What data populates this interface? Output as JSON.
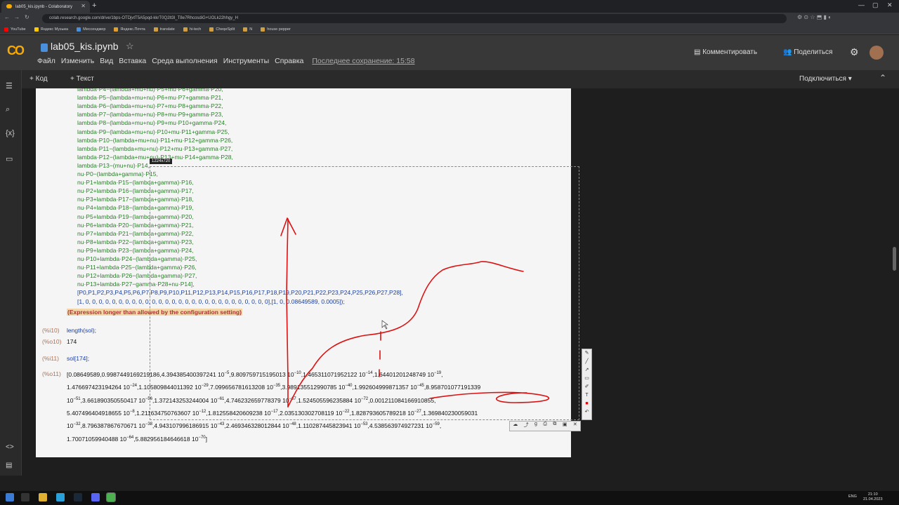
{
  "browser": {
    "tab_title": "lab05_kis.ipynb - Colaboratory",
    "url": "colab.research.google.com/drive/1bps-OTDjvtT5A5pqd-kkrT0Q2lt3I_T8e7RhcosdiG+UOLk22hhgy_H",
    "bookmarks": [
      "YouTube",
      "Яндекс Музыка",
      "Мессенджер",
      "Яндекс.Почта",
      "translate",
      "hi-tech",
      "CheqeSplit",
      "N",
      "house pepper"
    ],
    "bookmark_colors": [
      "#ff0000",
      "#ffcc00",
      "#4a8fdb",
      "#e0a030",
      "#d0a040",
      "#d0a040",
      "#d0a040",
      "#d0a040",
      "#d0a040"
    ]
  },
  "colab": {
    "notebook_title": "lab05_kis.ipynb",
    "menu": [
      "Файл",
      "Изменить",
      "Вид",
      "Вставка",
      "Среда выполнения",
      "Инструменты",
      "Справка"
    ],
    "last_saved": "Последнее сохранение: 15:58",
    "comment_label": "Комментировать",
    "share_label": "Поделиться",
    "add_code_label": "+ Код",
    "add_text_label": "+ Текст",
    "connect_label": "Подключиться"
  },
  "cell": {
    "code_lines": [
      "lambda·P4−(lambda+mu+nu)·P5+mu·P6+gamma·P20,",
      "lambda·P5−(lambda+mu+nu)·P6+mu·P7+gamma·P21,",
      "lambda·P6−(lambda+mu+nu)·P7+mu·P8+gamma·P22,",
      "lambda·P7−(lambda+mu+nu)·P8+mu·P9+gamma·P23,",
      "lambda·P8−(lambda+mu+nu)·P9+mu·P10+gamma·P24,",
      "lambda·P9−(lambda+mu+nu)·P10+mu·P11+gamma·P25,",
      "lambda·P10−(lambda+mu+nu)·P11+mu·P12+gamma·P26,",
      "lambda·P11−(lambda+mu+nu)·P12+mu·P13+gamma·P27,",
      "lambda·P12−(lambda+mu+nu)·P13+mu·P14+gamma·P28,",
      "lambda·P13−(mu+nu)·P14,",
      "nu·P0−(lambda+gamma)·P15,",
      "nu·P1+lambda·P15−(lambda+gamma)·P16,",
      "nu·P2+lambda·P16−(lambda+gamma)·P17,",
      "nu·P3+lambda·P17−(lambda+gamma)·P18,",
      "nu·P4+lambda·P18−(lambda+gamma)·P19,",
      "nu·P5+lambda·P19−(lambda+gamma)·P20,",
      "nu·P6+lambda·P20−(lambda+gamma)·P21,",
      "nu·P7+lambda·P21−(lambda+gamma)·P22,",
      "nu·P8+lambda·P22−(lambda+gamma)·P23,",
      "nu·P9+lambda·P23−(lambda+gamma)·P24,",
      "nu·P10+lambda·P24−(lambda+gamma)·P25,",
      "nu·P11+lambda·P25−(lambda+gamma)·P26,",
      "nu·P12+lambda·P26−(lambda+gamma)·P27,",
      "nu·P13+lambda·P27−gamma·P28+nu·P14],"
    ],
    "vars_line": "[P0,P1,P2,P3,P4,P5,P6,P7,P8,P9,P10,P11,P12,P13,P14,P15,P16,P17,P18,P19,P20,P21,P22,P23,P24,P25,P26,P27,P28],",
    "init_line": "[1, 0, 0, 0, 0, 0, 0, 0, 0, 0, 0, 0, 0, 0, 0, 0, 0, 0, 0, 0, 0, 0, 0, 0, 0, 0, 0, 0, 0],[1, 0, 0.08649589, 0.0005]);",
    "error": "(Expression longer than allowed by the configuration setting)",
    "i10_prompt": "(%i10)",
    "i10_input": "length(sol);",
    "o10_prompt": "(%o10)",
    "o10_output": "174",
    "i11_prompt": "(%i11)",
    "i11_input": "sol[174];",
    "o11_prompt": "(%o11)",
    "out_rows": [
      [
        [
          "[0.08649589,0.9987449169219186,4.394385400397241 10",
          "−5"
        ],
        [
          ",9.809759715195013 10",
          "−10"
        ],
        [
          ",1.465311071952122 10",
          "−14"
        ],
        [
          ",1.64401201248749 10",
          "−19"
        ],
        [
          ",",
          ""
        ]
      ],
      [
        [
          "1.476697423194264 10",
          "−24"
        ],
        [
          ",1.105809844011392 10",
          "−29"
        ],
        [
          ",7.099656781613208 10",
          "−35"
        ],
        [
          ",3.989135512990785 10",
          "−40"
        ],
        [
          ",1.992604999871357 10",
          "−45"
        ],
        [
          ",8.958701077191339",
          ""
        ]
      ],
      [
        [
          "10",
          "−51"
        ],
        [
          ",3.661890350550417 10",
          "−56"
        ],
        [
          ",1.372143253244004 10",
          "−61"
        ],
        [
          ",4.746232659778379 10",
          "−67"
        ],
        [
          ",1.524505596235884 10",
          "−72"
        ],
        [
          ",0.001211084166910855,",
          ""
        ]
      ],
      [
        [
          "5.407496404918655 10",
          "−8"
        ],
        [
          ",1.211634750763607 10",
          "−12"
        ],
        [
          ",1.812558420609238 10",
          "−17"
        ],
        [
          ",2.035130302708119 10",
          "−22"
        ],
        [
          ",1.828793605789218 10",
          "−27"
        ],
        [
          ",1.369840230059031",
          ""
        ]
      ],
      [
        [
          "10",
          "−32"
        ],
        [
          ",8.796387867670671 10",
          "−38"
        ],
        [
          ",4.943107996186915 10",
          "−43"
        ],
        [
          ",2.469346328012844 10",
          "−48"
        ],
        [
          ",1.110287445823941 10",
          "−53"
        ],
        [
          ",4.538563974927231 10",
          "−59"
        ],
        [
          ",",
          ""
        ]
      ],
      [
        [
          "1.70071059940488 10",
          "−64"
        ],
        [
          ",5.882956184646618 10",
          "−70"
        ],
        [
          "]",
          ""
        ]
      ]
    ]
  },
  "overlay": {
    "size_tag": "1224x720"
  },
  "taskbar": {
    "lang": "ENG",
    "time": "21:10",
    "date": "21.04.2023"
  }
}
